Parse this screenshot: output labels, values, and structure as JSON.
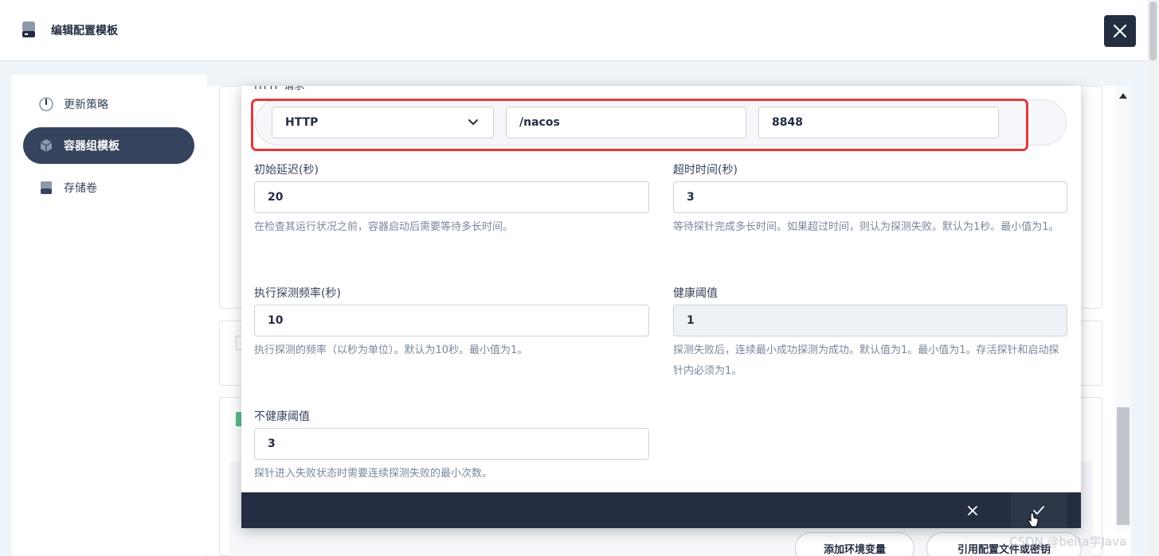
{
  "header": {
    "title": "编辑配置模板"
  },
  "sidebar": {
    "items": [
      {
        "label": "更新策略",
        "icon": "gauge-icon",
        "active": false
      },
      {
        "label": "容器组模板",
        "icon": "cube-icon",
        "active": true
      },
      {
        "label": "存储卷",
        "icon": "disk-icon",
        "active": false
      }
    ]
  },
  "modal": {
    "section_label": "HTTP 请求",
    "http": {
      "scheme": "HTTP",
      "path": "/nacos",
      "port": "8848"
    },
    "fields": {
      "initial_delay": {
        "label": "初始延迟(秒)",
        "value": "20",
        "desc": "在检查其运行状况之前，容器启动后需要等待多长时间。"
      },
      "timeout": {
        "label": "超时时间(秒)",
        "value": "3",
        "desc": "等待探针完成多长时间。如果超过时间，则认为探测失败。默认为1秒。最小值为1。"
      },
      "period": {
        "label": "执行探测频率(秒)",
        "value": "10",
        "desc": "执行探测的频率（以秒为单位）。默认为10秒。最小值为1。"
      },
      "success_threshold": {
        "label": "健康阈值",
        "value": "1",
        "desc": "探测失败后，连续最小成功探测为成功。默认值为1。最小值为1。存活探针和启动探针内必须为1。"
      },
      "failure_threshold": {
        "label": "不健康阈值",
        "value": "3",
        "desc": "探针进入失败状态时需要连续探测失败的最小次数。"
      }
    }
  },
  "bottom_buttons": {
    "add_env": "添加环境变量",
    "ref_config": "引用配置文件或密钥"
  },
  "watermark": "CSDN @beita学Java",
  "colors": {
    "dark": "#242e42",
    "highlight": "#e5363a",
    "active_nav": "#36435c"
  }
}
